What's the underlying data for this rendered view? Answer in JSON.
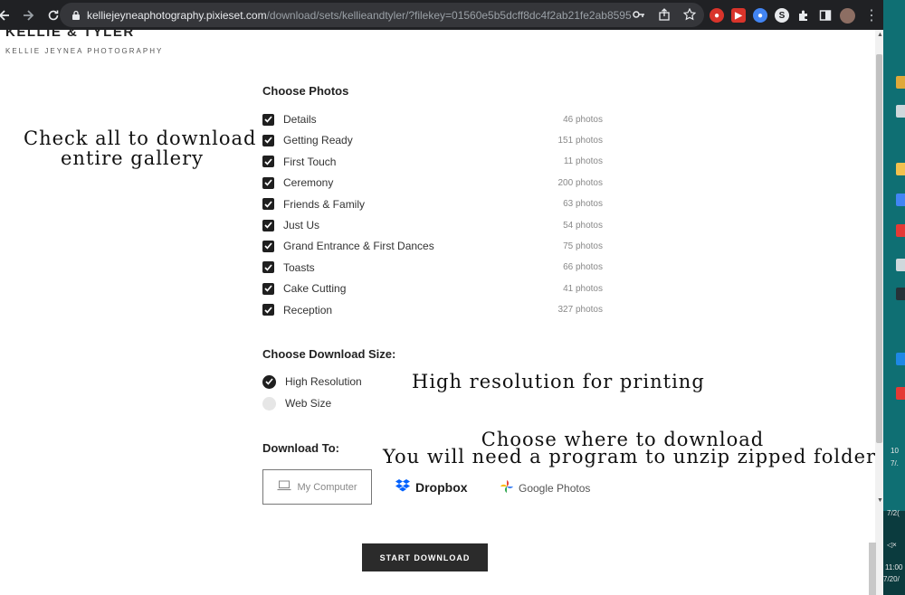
{
  "browser": {
    "url_domain": "kelliejeyneaphotography.pixieset.com",
    "url_path": "/download/sets/kellieandtyler/?filekey=01560e5b5dcff8dc4f2ab21fe2ab8595",
    "icons": [
      "back-icon",
      "forward-icon",
      "reload-icon",
      "lock-icon",
      "key-icon",
      "share-icon",
      "star-icon",
      "extensions-icon",
      "sidebar-icon",
      "profile-avatar",
      "menu-icon"
    ]
  },
  "site": {
    "title": "KELLIE & TYLER",
    "subtitle": "KELLIE JEYNEA PHOTOGRAPHY"
  },
  "choose_photos": {
    "heading": "Choose Photos",
    "items": [
      {
        "label": "Details",
        "count": "46 photos",
        "checked": true
      },
      {
        "label": "Getting Ready",
        "count": "151 photos",
        "checked": true
      },
      {
        "label": "First Touch",
        "count": "11 photos",
        "checked": true
      },
      {
        "label": "Ceremony",
        "count": "200 photos",
        "checked": true
      },
      {
        "label": "Friends & Family",
        "count": "63 photos",
        "checked": true
      },
      {
        "label": "Just Us",
        "count": "54 photos",
        "checked": true
      },
      {
        "label": "Grand Entrance & First Dances",
        "count": "75 photos",
        "checked": true
      },
      {
        "label": "Toasts",
        "count": "66 photos",
        "checked": true
      },
      {
        "label": "Cake Cutting",
        "count": "41 photos",
        "checked": true
      },
      {
        "label": "Reception",
        "count": "327 photos",
        "checked": true
      }
    ]
  },
  "download_size": {
    "heading": "Choose Download Size:",
    "options": [
      {
        "label": "High Resolution",
        "selected": true
      },
      {
        "label": "Web Size",
        "selected": false
      }
    ]
  },
  "download_to": {
    "heading": "Download To:",
    "my_computer": "My Computer",
    "dropbox": "Dropbox",
    "google_photos": "Google Photos"
  },
  "start_button": "START DOWNLOAD",
  "annotations": {
    "check_all_1": "Check all to download",
    "check_all_2": "entire gallery",
    "high_res": "High resolution for printing",
    "where_1": "Choose where to download",
    "where_2": "You will need a program to unzip zipped folders!"
  },
  "taskbar": {
    "time_1": "11:00",
    "date_1": "7/20/",
    "time_2": "10",
    "date_2": "7/.",
    "date_3": "7/2("
  },
  "colors": {
    "chrome_bg": "#202124",
    "omnibox_bg": "#35363a",
    "check_fill": "#1f1f1f",
    "button_bg": "#2b2b2b",
    "desktop_bg": "#0f6f73"
  }
}
